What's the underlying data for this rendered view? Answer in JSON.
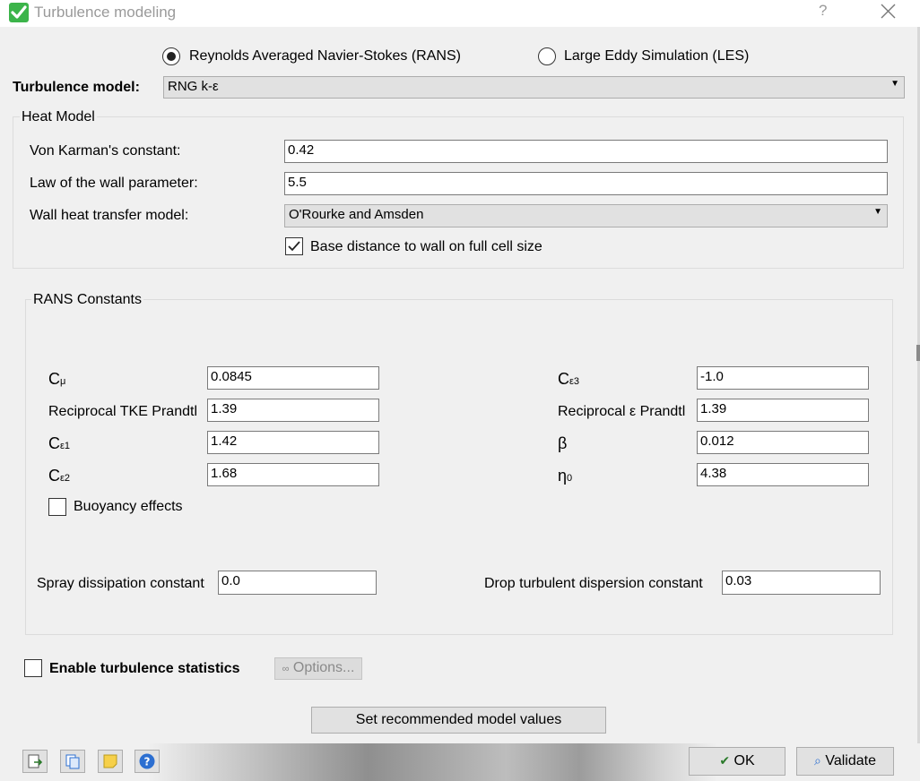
{
  "window": {
    "title": "Turbulence modeling",
    "help": "?",
    "close_icon": "close-icon",
    "app_icon": "green-check-icon"
  },
  "method": {
    "rans_label": "Reynolds Averaged Navier-Stokes (RANS)",
    "les_label": "Large Eddy Simulation (LES)",
    "selected": "RANS"
  },
  "turbulence_model": {
    "label": "Turbulence model:",
    "value": "RNG k-ε"
  },
  "heat_model": {
    "title": "Heat Model",
    "von_karman_label": "Von Karman's constant:",
    "von_karman_value": "0.42",
    "law_of_wall_label": "Law of the wall parameter:",
    "law_of_wall_value": "5.5",
    "wall_heat_label": "Wall heat transfer model:",
    "wall_heat_value": "O'Rourke and Amsden",
    "base_distance_label": "Base distance to wall on full cell size",
    "base_distance_checked": true
  },
  "rans_constants": {
    "title": "RANS Constants",
    "c_mu": {
      "base": "C",
      "sub": "μ",
      "value": "0.0845"
    },
    "tke_prandtl": {
      "label": "Reciprocal TKE Prandtl",
      "value": "1.39"
    },
    "c_e1": {
      "base": "C",
      "sub": "ε1",
      "value": "1.42"
    },
    "c_e2": {
      "base": "C",
      "sub": "ε2",
      "value": "1.68"
    },
    "c_e3": {
      "base": "C",
      "sub": "ε3",
      "value": "-1.0"
    },
    "eps_prandtl": {
      "label": "Reciprocal ε Prandtl",
      "value": "1.39"
    },
    "beta": {
      "label": "β",
      "value": "0.012"
    },
    "eta0": {
      "base": "η",
      "sub": "0",
      "value": "4.38"
    },
    "buoyancy_label": "Buoyancy effects",
    "buoyancy_checked": false,
    "spray_label": "Spray dissipation constant",
    "spray_value": "0.0",
    "drop_label": "Drop turbulent dispersion constant",
    "drop_value": "0.03"
  },
  "statistics": {
    "label": "Enable turbulence statistics",
    "checked": false,
    "options_label": "Options...",
    "options_icon": "glasses-icon"
  },
  "actions": {
    "recommended_label": "Set recommended model values",
    "ok_label": "OK",
    "ok_icon": "check-icon",
    "validate_label": "Validate",
    "validate_icon": "magnifier-icon"
  },
  "toolbar": {
    "icons": [
      "export-icon",
      "copy-icon",
      "note-icon",
      "help-icon"
    ]
  },
  "colors": {
    "accent_check": "#3cb44a",
    "help_blue": "#2c6fd1"
  }
}
